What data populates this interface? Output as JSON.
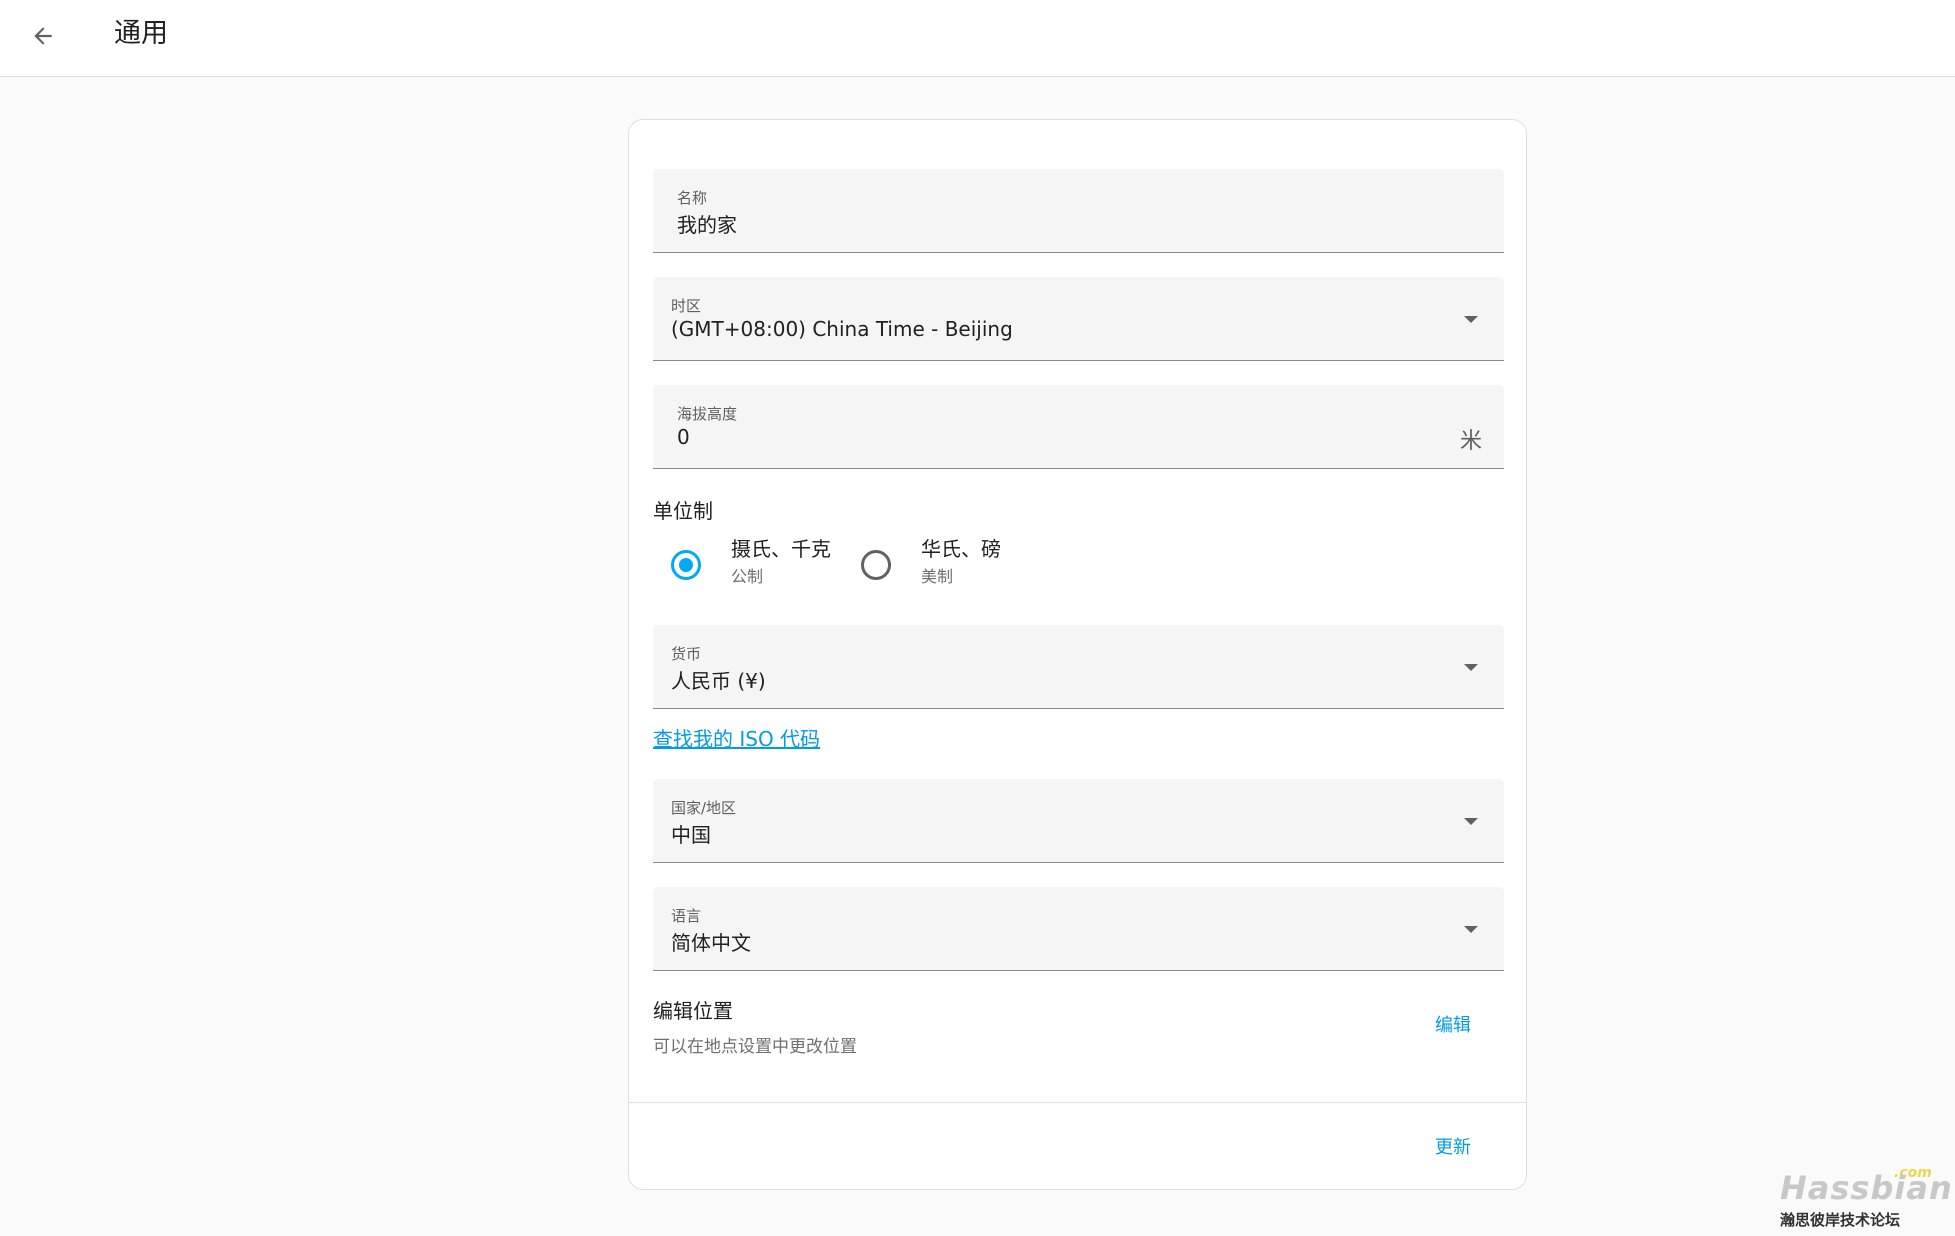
{
  "header": {
    "title": "通用",
    "back_icon": "arrow-left-icon"
  },
  "form": {
    "name": {
      "label": "名称",
      "value": "我的家"
    },
    "timezone": {
      "label": "时区",
      "value": "(GMT+08:00) China Time - Beijing"
    },
    "elevation": {
      "label": "海拔高度",
      "value": "0",
      "unit": "米"
    },
    "unit_system": {
      "label": "单位制",
      "options": [
        {
          "title": "摄氏、千克",
          "subtitle": "公制",
          "checked": true
        },
        {
          "title": "华氏、磅",
          "subtitle": "美制",
          "checked": false
        }
      ]
    },
    "currency": {
      "label": "货币",
      "value": "人民币 (¥)"
    },
    "iso_link": "查找我的 ISO 代码",
    "country": {
      "label": "国家/地区",
      "value": "中国"
    },
    "language": {
      "label": "语言",
      "value": "简体中文"
    },
    "location": {
      "title": "编辑位置",
      "description": "可以在地点设置中更改位置",
      "edit_label": "编辑"
    },
    "update_label": "更新"
  },
  "watermark": {
    "logo": "Hassbian",
    "suffix": ".com",
    "subtitle": "瀚思彼岸技术论坛"
  },
  "colors": {
    "accent": "#03a9f4",
    "link": "#039be5",
    "background": "#fafafa",
    "field_bg": "#f5f5f5"
  }
}
